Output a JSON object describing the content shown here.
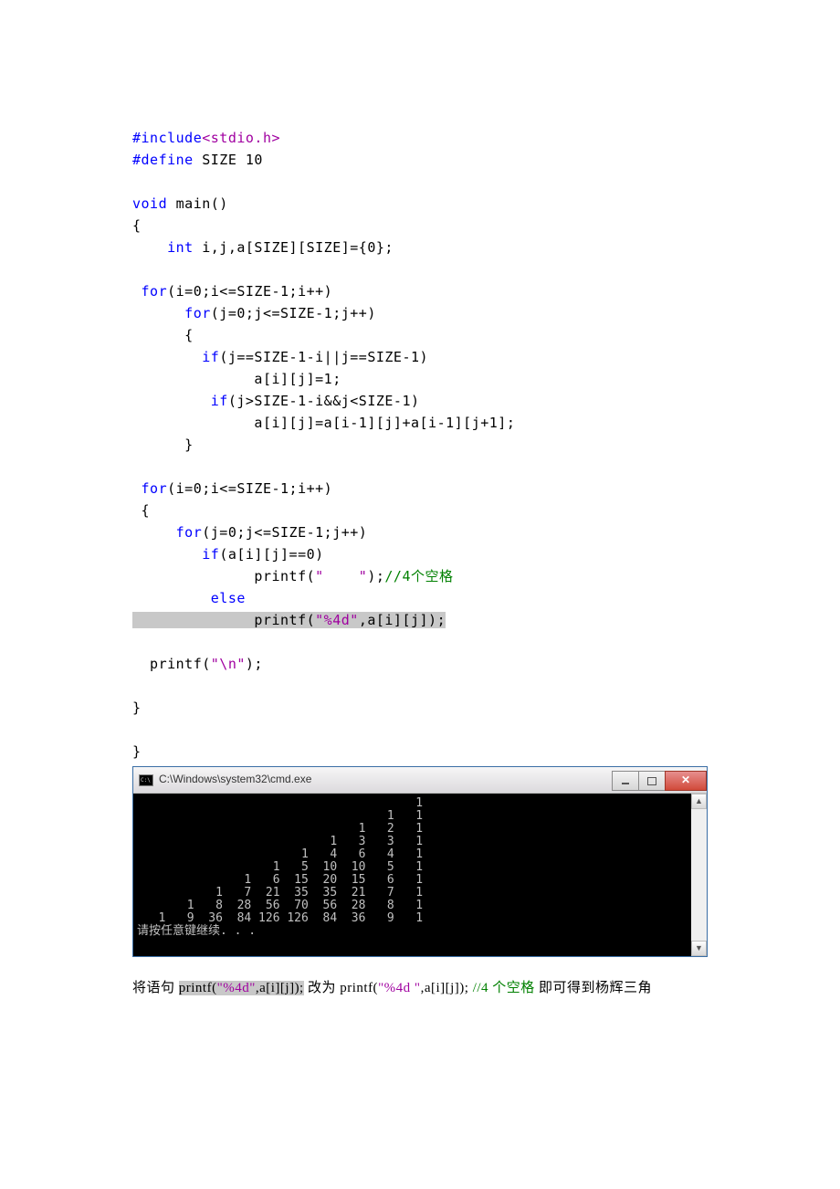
{
  "code": {
    "l1a": "#include",
    "l1b": "<stdio.h>",
    "l2a": "#define",
    "l2b": " SIZE 10",
    "l3a": "void",
    "l3b": " main()",
    "l4": "{",
    "l5a": "    int",
    "l5b": " i,j,a[SIZE][SIZE]={0};",
    "l6a": " for",
    "l6b": "(i=0;i<=SIZE-1;i++)",
    "l7a": "      for",
    "l7b": "(j=0;j<=SIZE-1;j++)",
    "l8": "      {",
    "l9a": "        if",
    "l9b": "(j==SIZE-1-i||j==SIZE-1)",
    "l10": "              a[i][j]=1;",
    "l11a": "         if",
    "l11b": "(j>SIZE-1-i&&j<SIZE-1)",
    "l12": "              a[i][j]=a[i-1][j]+a[i-1][j+1];",
    "l13": "      }",
    "l14a": " for",
    "l14b": "(i=0;i<=SIZE-1;i++)",
    "l15": " {",
    "l16a": "     for",
    "l16b": "(j=0;j<=SIZE-1;j++)",
    "l17a": "        if",
    "l17b": "(a[i][j]==0)",
    "l18a": "              printf(",
    "l18b": "\"    \"",
    "l18c": ");",
    "l18d": "//4个空格",
    "l19": "         else",
    "l20a": "              printf(",
    "l20b": "\"%4d\"",
    "l20c": ",a[i][j]);",
    "l21a": "  printf(",
    "l21b": "\"\\n\"",
    "l21c": ");",
    "l22": "}",
    "l23": "}"
  },
  "window": {
    "title": "C:\\Windows\\system32\\cmd.exe"
  },
  "console": {
    "r0": "                                       1",
    "r1": "                                   1   1",
    "r2": "                               1   2   1",
    "r3": "                           1   3   3   1",
    "r4": "                       1   4   6   4   1",
    "r5": "                   1   5  10  10   5   1",
    "r6": "               1   6  15  20  15   6   1",
    "r7": "           1   7  21  35  35  21   7   1",
    "r8": "       1   8  28  56  70  56  28   8   1",
    "r9": "   1   9  36  84 126 126  84  36   9   1",
    "prompt": "请按任意键继续. . ."
  },
  "footer": {
    "t1": "将语句 ",
    "t2a": "printf(",
    "t2b": "\"%4d\"",
    "t2c": ",a[i][j]);",
    "t3": " 改为 printf(",
    "t4": "\"%4d    \"",
    "t5": ",a[i][j]);",
    "t6": " //4 个空格",
    "t7": "   即可得到杨辉三角"
  },
  "chart_data": {
    "type": "table",
    "title": "Pascal's triangle (right-aligned, SIZE=10)",
    "rows": [
      [
        1
      ],
      [
        1,
        1
      ],
      [
        1,
        2,
        1
      ],
      [
        1,
        3,
        3,
        1
      ],
      [
        1,
        4,
        6,
        4,
        1
      ],
      [
        1,
        5,
        10,
        10,
        5,
        1
      ],
      [
        1,
        6,
        15,
        20,
        15,
        6,
        1
      ],
      [
        1,
        7,
        21,
        35,
        35,
        21,
        7,
        1
      ],
      [
        1,
        8,
        28,
        56,
        70,
        56,
        28,
        8,
        1
      ],
      [
        1,
        9,
        36,
        84,
        126,
        126,
        84,
        36,
        9,
        1
      ]
    ]
  }
}
